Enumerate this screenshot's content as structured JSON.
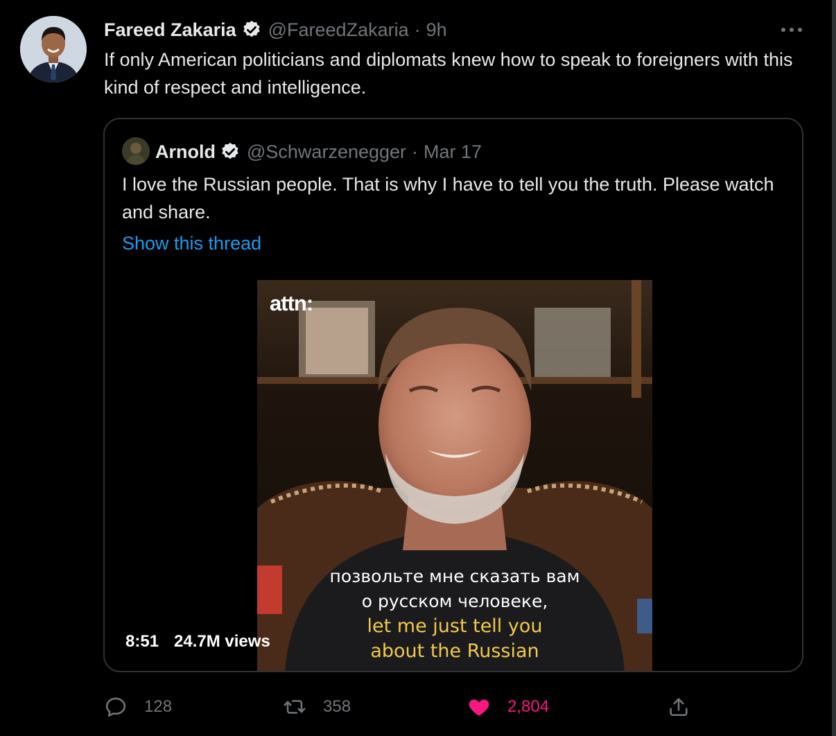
{
  "tweet": {
    "author": {
      "display_name": "Fareed Zakaria",
      "handle": "@FareedZakaria",
      "verified": true
    },
    "time": "9h",
    "separator": "·",
    "text": "If only American politicians and diplomats knew how to speak to foreigners with this kind of respect and intelligence.",
    "more_icon": "more-horizontal-icon"
  },
  "quoted_tweet": {
    "author": {
      "display_name": "Arnold",
      "handle": "@Schwarzenegger",
      "verified": true
    },
    "time": "Mar 17",
    "separator": "·",
    "text": "I love the Russian people. That is why I have to tell you the truth. Please watch and share.",
    "show_thread_label": "Show this thread",
    "video": {
      "brand_logo": "attn:",
      "caption_ru_line1": "позвольте мне сказать вам",
      "caption_ru_line2": "о русском человеке,",
      "caption_en_line1": "let me just tell you",
      "caption_en_line2": "about the Russian",
      "duration": "8:51",
      "views": "24.7M views"
    }
  },
  "actions": {
    "reply": {
      "icon": "reply-icon",
      "count": "128"
    },
    "retweet": {
      "icon": "retweet-icon",
      "count": "358"
    },
    "like": {
      "icon": "heart-icon",
      "count": "2,804",
      "liked": true
    },
    "share": {
      "icon": "share-icon"
    }
  },
  "colors": {
    "background": "#000000",
    "text": "#e7e9ea",
    "secondary": "#71767b",
    "link": "#1d9bf0",
    "like": "#f91880",
    "border": "#2f3336",
    "caption_en": "#f2c94c"
  }
}
